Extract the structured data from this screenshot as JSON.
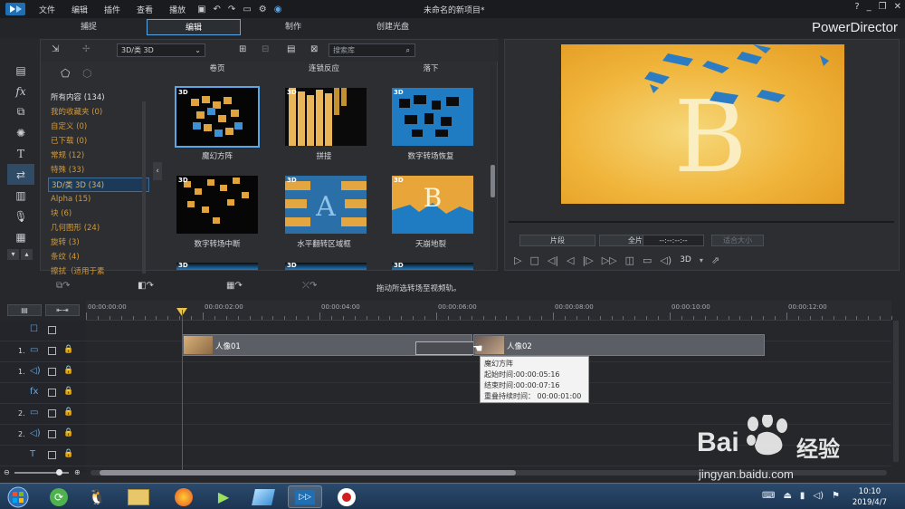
{
  "menu": [
    "文件",
    "编辑",
    "插件",
    "查看",
    "播放"
  ],
  "window_title": "未命名的新项目*",
  "modes": [
    "捕捉",
    "编辑",
    "制作",
    "创建光盘"
  ],
  "brand": "PowerDirector",
  "library": {
    "filter": "3D/类 3D",
    "search_placeholder": "搜索库",
    "categories": [
      {
        "label": "所有内容 (134)",
        "style": "white"
      },
      {
        "label": "我的收藏夹 (0)",
        "style": "orange"
      },
      {
        "label": "自定义 (0)",
        "style": "orange"
      },
      {
        "label": "已下载 (0)",
        "style": "orange"
      },
      {
        "label": "常规 (12)",
        "style": "orange"
      },
      {
        "label": "特殊 (33)",
        "style": "orange"
      },
      {
        "label": "3D/类 3D (34)",
        "style": "selected"
      },
      {
        "label": "Alpha (15)",
        "style": "orange"
      },
      {
        "label": "块 (6)",
        "style": "orange"
      },
      {
        "label": "几何图形 (24)",
        "style": "orange"
      },
      {
        "label": "旋转 (3)",
        "style": "orange"
      },
      {
        "label": "条纹 (4)",
        "style": "orange"
      },
      {
        "label": "擦拭（适用于素",
        "style": "orange"
      }
    ],
    "top_labels": [
      "卷页",
      "连锁反应",
      "落下"
    ],
    "items": [
      {
        "label": "魔幻方阵",
        "tag": "3D"
      },
      {
        "label": "拼接",
        "tag": "3D"
      },
      {
        "label": "数字转场恢复",
        "tag": "3D"
      },
      {
        "label": "数字转场中断",
        "tag": "3D"
      },
      {
        "label": "水平翻转区域框",
        "tag": "3D"
      },
      {
        "label": "天崩地裂",
        "tag": "3D"
      }
    ],
    "partial_tags": [
      "3D",
      "3D",
      "3D"
    ]
  },
  "preview": {
    "letter": "B",
    "segment_btn": "片段",
    "full_btn": "全片",
    "timecode": "--:--:--:--",
    "fit": "适合大小",
    "mode_3d": "3D"
  },
  "edit_hint": "拖动所选转场至视频轨。",
  "timeline": {
    "ticks": [
      "00:00:00:00",
      "00:00:02:00",
      "00:00:04:00",
      "00:00:06:00",
      "00:00:08:00",
      "00:00:10:00",
      "00:00:12:00"
    ],
    "tracks": [
      {
        "num": "",
        "icon": "☐"
      },
      {
        "num": "1.",
        "icon": "▭"
      },
      {
        "num": "1.",
        "icon": "◁)"
      },
      {
        "num": "",
        "icon": "fx"
      },
      {
        "num": "2.",
        "icon": "▭"
      },
      {
        "num": "2.",
        "icon": "◁)"
      },
      {
        "num": "",
        "icon": "T"
      }
    ],
    "clips": [
      {
        "label": "人像01"
      },
      {
        "label": "人像02"
      }
    ],
    "tooltip": {
      "title": "魔幻方阵",
      "start": "起始时间:00:00:05:16",
      "end": "结束时间:00:00:07:16",
      "overlap": "重叠持续时间： 00:00:01:00"
    }
  },
  "taskbar": {
    "time": "10:10",
    "date": "2019/4/7"
  },
  "watermark": {
    "brand": "Bai",
    "brand2": "经验",
    "url": "jingyan.baidu.com"
  },
  "colors": {
    "accent": "#5aa7e8",
    "category": "#d29a3b",
    "playhead": "#d02b2b"
  }
}
